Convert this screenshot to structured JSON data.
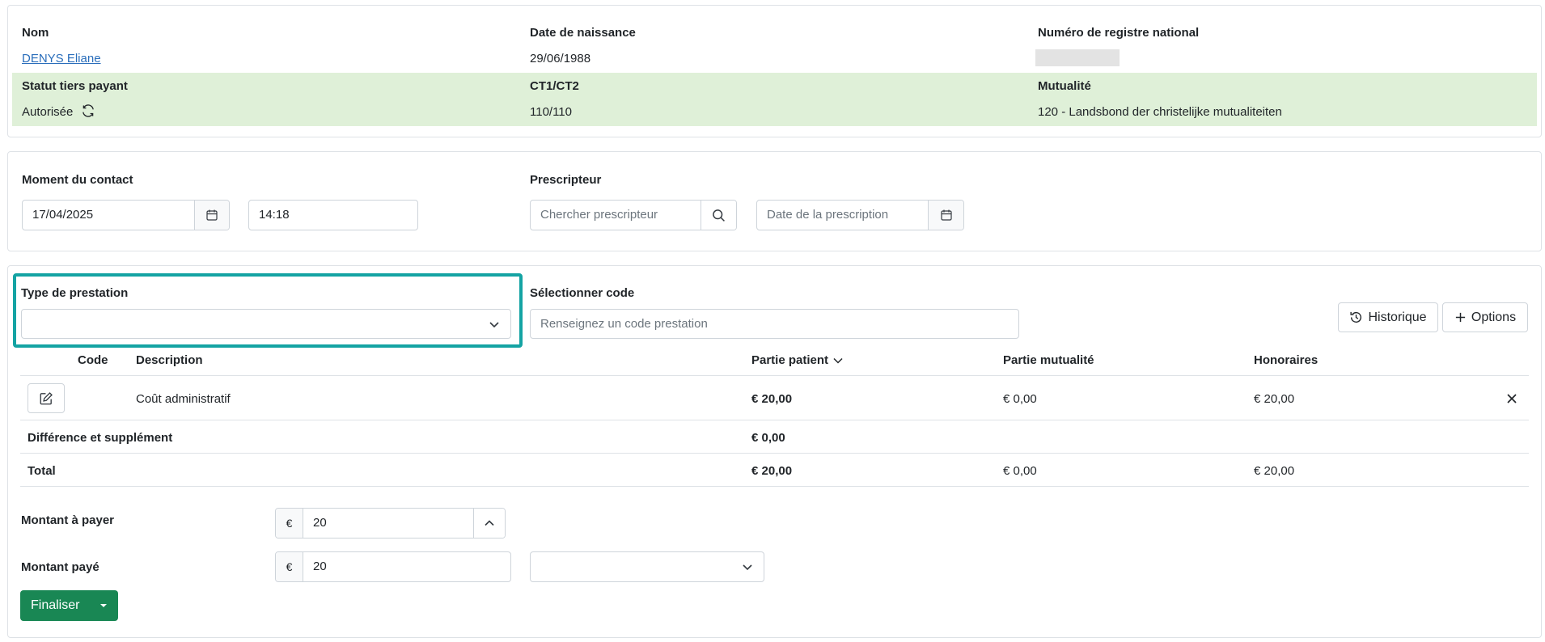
{
  "patient": {
    "nom_label": "Nom",
    "nom_value": "DENYS Eliane",
    "dob_label": "Date de naissance",
    "dob_value": "29/06/1988",
    "nrn_label": "Numéro de registre national",
    "statut_label": "Statut tiers payant",
    "statut_value": "Autorisée",
    "ct_label": "CT1/CT2",
    "ct_value": "110/110",
    "mutualite_label": "Mutualité",
    "mutualite_value": "120 - Landsbond der christelijke mutualiteiten"
  },
  "contact": {
    "moment_label": "Moment du contact",
    "date_value": "17/04/2025",
    "time_value": "14:18",
    "prescripteur_label": "Prescripteur",
    "prescripteur_placeholder": "Chercher prescripteur",
    "prescription_date_placeholder": "Date de la prescription"
  },
  "prestation": {
    "type_label": "Type de prestation",
    "type_value": "",
    "code_label": "Sélectionner code",
    "code_placeholder": "Renseignez un code prestation",
    "historique_label": "Historique",
    "options_label": "Options"
  },
  "table": {
    "headers": {
      "code": "Code",
      "description": "Description",
      "partie_patient": "Partie patient",
      "partie_mutualite": "Partie mutualité",
      "honoraires": "Honoraires"
    },
    "rows": [
      {
        "code": "",
        "description": "Coût administratif",
        "partie_patient": "€ 20,00",
        "partie_mutualite": "€ 0,00",
        "honoraires": "€ 20,00"
      }
    ],
    "difference": {
      "label": "Différence et supplément",
      "partie_patient": "€ 0,00"
    },
    "total": {
      "label": "Total",
      "partie_patient": "€ 20,00",
      "partie_mutualite": "€ 0,00",
      "honoraires": "€ 20,00"
    }
  },
  "payment": {
    "montant_a_payer_label": "Montant à payer",
    "montant_a_payer_currency": "€",
    "montant_a_payer_value": "20",
    "montant_paye_label": "Montant payé",
    "montant_paye_currency": "€",
    "montant_paye_value": "20",
    "payment_method_value": "",
    "finaliser_label": "Finaliser"
  },
  "colors": {
    "accent_highlight": "#14a3a3",
    "success": "#198754",
    "status_band": "#dff0d8",
    "link": "#2a6ebb"
  },
  "icons": [
    "refresh-icon",
    "calendar-icon",
    "search-icon",
    "chevron-down-icon",
    "history-icon",
    "plus-icon",
    "edit-icon",
    "close-icon",
    "chevron-up-icon",
    "caret-down-icon"
  ]
}
